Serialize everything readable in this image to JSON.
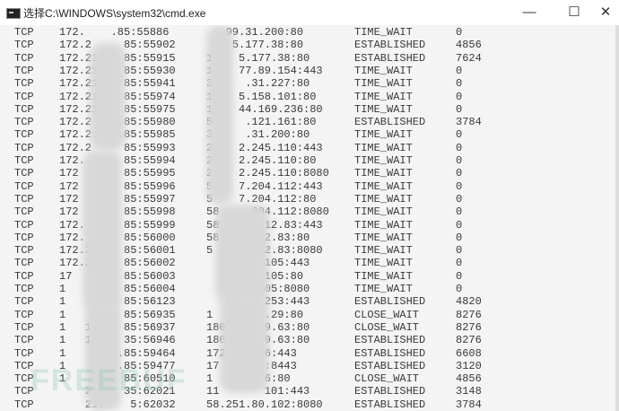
{
  "window": {
    "title": "选择C:\\WINDOWS\\system32\\cmd.exe",
    "minimize": "—",
    "maximize": "☐",
    "close": "✕",
    "icon": "console-icon"
  },
  "rows": [
    [
      "TCP",
      "172.    .85:55886",
      "   99.31.200:80",
      "TIME_WAIT",
      "0"
    ],
    [
      "TCP",
      "172.2     85:55902",
      "    5.177.38:80",
      "ESTABLISHED",
      "4856"
    ],
    [
      "TCP",
      "172.21    85:55915",
      "14   5.177.38:80",
      "ESTABLISHED",
      "7624"
    ],
    [
      "TCP",
      "172.21    85:55930",
      "1    77.89.154:443",
      "TIME_WAIT",
      "0"
    ],
    [
      "TCP",
      "172.21    85:55941",
      "3     .31.227:80",
      "TIME_WAIT",
      "0"
    ],
    [
      "TCP",
      "172.21    85:55974",
      "1    5.158.101:80",
      "TIME_WAIT",
      "0"
    ],
    [
      "TCP",
      "172.21    85:55975",
      "1    44.169.236:80",
      "TIME_WAIT",
      "0"
    ],
    [
      "TCP",
      "172.2    .85:55980",
      "5     .121.161:80",
      "ESTABLISHED",
      "3784"
    ],
    [
      "TCP",
      "172.2    .85:55985",
      "3     .31.200:80",
      "TIME_WAIT",
      "0"
    ],
    [
      "TCP",
      "172.2     85:55993",
      "2    2.245.110:443",
      "TIME_WAIT",
      "0"
    ],
    [
      "TCP",
      "172.      85:55994",
      "2    2.245.110:80",
      "TIME_WAIT",
      "0"
    ],
    [
      "TCP",
      "172       85:55995",
      "2    2.245.110:8080",
      "TIME_WAIT",
      "0"
    ],
    [
      "TCP",
      "172       85:55996",
      "5    7.204.112:443",
      "TIME_WAIT",
      "0"
    ],
    [
      "TCP",
      "172       85:55997",
      "5    7.204.112:80",
      "TIME_WAIT",
      "0"
    ],
    [
      "TCP",
      "172       85:55998",
      "58    .204.112:8080",
      "TIME_WAIT",
      "0"
    ],
    [
      "TCP",
      "172.      85:55999",
      "58     .112.83:443",
      "TIME_WAIT",
      "0"
    ],
    [
      "TCP",
      "172.      85:56000",
      "58.    112.83:80",
      "TIME_WAIT",
      "0"
    ],
    [
      "TCP",
      "172.2     85:56001",
      "5      112.83:8080",
      "TIME_WAIT",
      "0"
    ],
    [
      "TCP",
      "172.2     85:56002",
      "      12.105:443",
      "TIME_WAIT",
      "0"
    ],
    [
      "TCP",
      "17        85:56003",
      "   5   2.105:80",
      "TIME_WAIT",
      "0"
    ],
    [
      "TCP",
      "1         85:56004",
      "   51   105:8080",
      "TIME_WAIT",
      "0"
    ],
    [
      "TCP",
      "1         85:56123",
      "   29.   253:443",
      "ESTABLISHED",
      "4820"
    ],
    [
      "TCP",
      "1         85:56935",
      "1        .29:80",
      "CLOSE_WAIT",
      "8276"
    ],
    [
      "TCP",
      "1   1     85:56937",
      "180.     9.63:80",
      "CLOSE_WAIT",
      "8276"
    ],
    [
      "TCP",
      "1   1     35:56946",
      "180.1    9.63:80",
      "ESTABLISHED",
      "8276"
    ],
    [
      "TCP",
      "1        .85:59464",
      "172     56:443",
      "ESTABLISHED",
      "6608"
    ],
    [
      "TCP",
      "1        .85:59477",
      "17      5:8443",
      "ESTABLISHED",
      "3120"
    ],
    [
      "TCP",
      "1         85:60510",
      "1        6:80",
      "CLOSE_WAIT",
      "4856"
    ],
    [
      "TCP",
      "    21    35:62021",
      "11       101:443",
      "ESTABLISHED",
      "3148"
    ],
    [
      "TCP",
      "    21.    5:62032",
      "58.251.80.102:8080",
      "ESTABLISHED",
      "3784"
    ]
  ],
  "watermark": "FREEBUF"
}
